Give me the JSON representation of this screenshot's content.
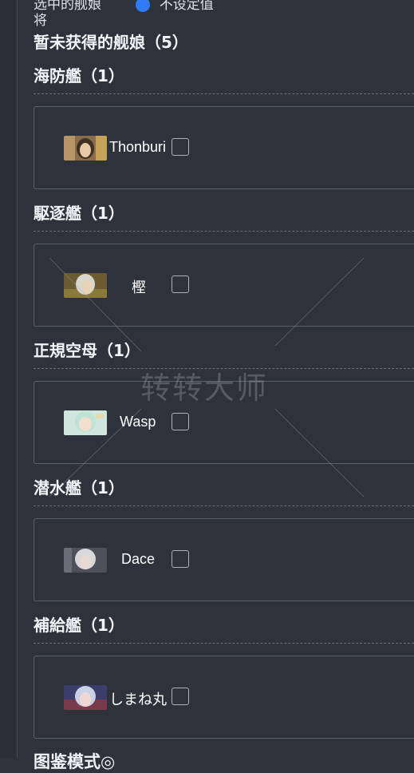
{
  "header": {
    "top_partial": "选中的舰娘",
    "top_option": "不设定值",
    "top_line2": "将",
    "title": "暂未获得的舰娘（5）"
  },
  "sections": [
    {
      "label": "海防艦（1）",
      "ship": "Thonburi",
      "avatar": {
        "bg": "#8a6e4a",
        "skin": "#e8c9a8",
        "hair": "#3f3124"
      }
    },
    {
      "label": "駆逐艦（1）",
      "ship": "樫",
      "avatar": {
        "bg": "#6b5a32",
        "skin": "#e9d3b8",
        "hair": "#d8d6d0"
      }
    },
    {
      "label": "正規空母（1）",
      "ship": "Wasp",
      "avatar": {
        "bg": "#cfe6df",
        "skin": "#f2dfd0",
        "hair": "#bde3d3"
      }
    },
    {
      "label": "潜水艦（1）",
      "ship": "Dace",
      "avatar": {
        "bg": "#4d4f59",
        "skin": "#e7dad2",
        "hair": "#d7d7dc"
      }
    },
    {
      "label": "補給艦（1）",
      "ship": "しまね丸",
      "avatar": {
        "bg": "#3b3d6b",
        "skin": "#efd8d3",
        "hair": "#c9d1e6"
      }
    }
  ],
  "footer": {
    "partial_heading": "图鉴模式◎"
  },
  "watermark": "转转大师",
  "colors": {
    "background": "#2e323b",
    "accent": "#2f7cf6",
    "border": "#5b616b"
  }
}
